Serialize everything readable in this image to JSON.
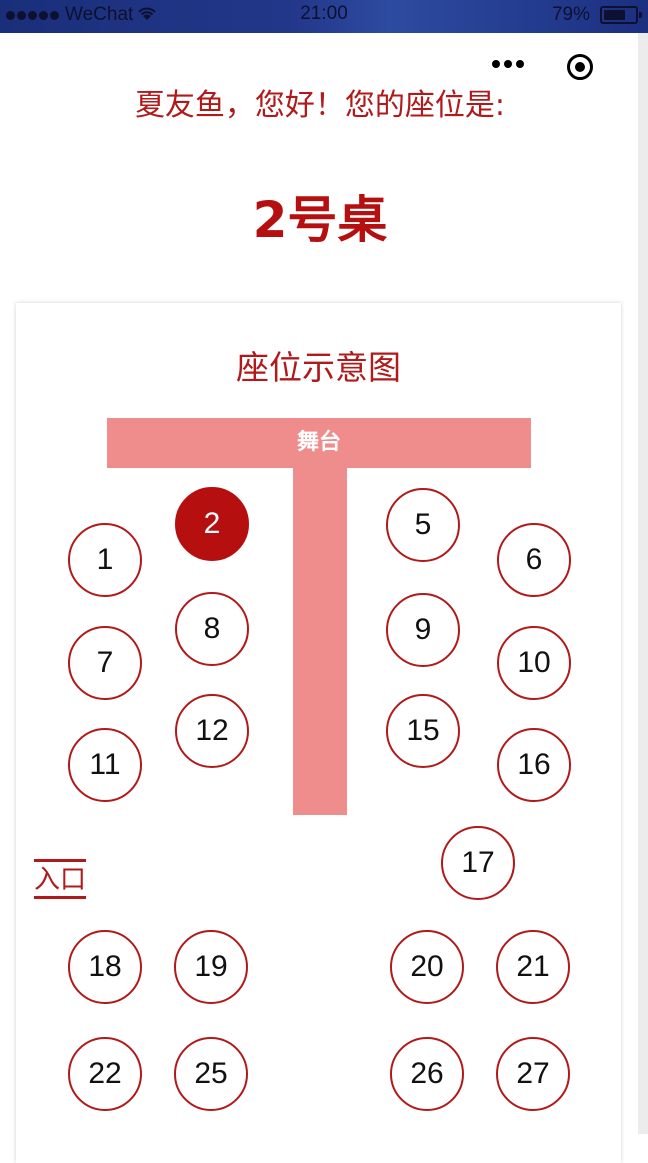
{
  "status_bar": {
    "carrier": "WeChat",
    "time": "21:00",
    "battery_percent": "79%",
    "battery_level": 0.79
  },
  "capsule": {
    "more_icon": "more-dots-icon",
    "close_icon": "target-close-icon"
  },
  "greeting": "夏友鱼，您好！您的座位是:",
  "seat_result": "2号桌",
  "map": {
    "title": "座位示意图",
    "stage_label": "舞台",
    "entrance_label": "入口",
    "selected_table": "2",
    "tables": [
      "1",
      "2",
      "5",
      "6",
      "7",
      "8",
      "9",
      "10",
      "11",
      "12",
      "15",
      "16",
      "17",
      "18",
      "19",
      "20",
      "21",
      "22",
      "25",
      "26",
      "27"
    ]
  },
  "colors": {
    "accent": "#b50f0f",
    "stage": "#ef8c8c",
    "status_bar": "#23378a"
  }
}
